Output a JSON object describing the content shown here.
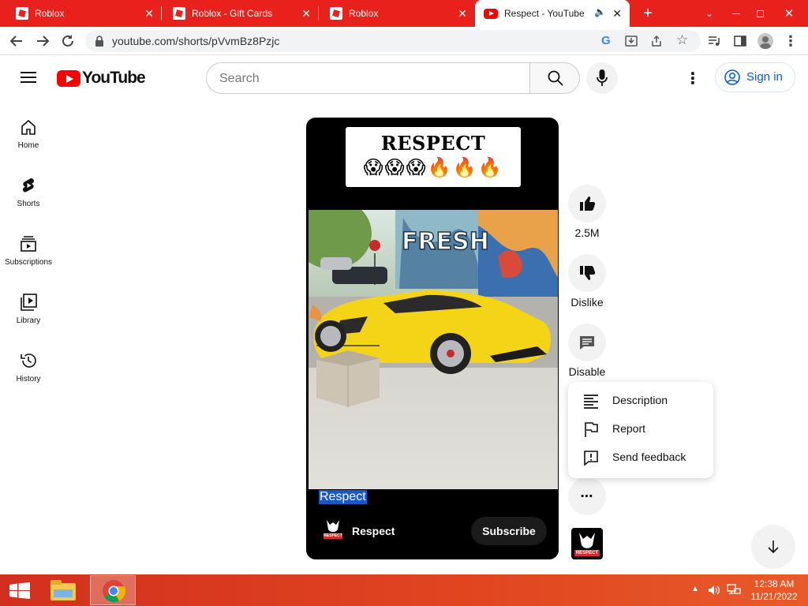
{
  "browser": {
    "tabs": [
      {
        "title": "Roblox",
        "active": false
      },
      {
        "title": "Roblox - Gift Cards",
        "active": false
      },
      {
        "title": "Roblox",
        "active": false
      },
      {
        "title": "Respect - YouTube",
        "active": true
      }
    ],
    "url": "youtube.com/shorts/pVvmBz8Pzjc"
  },
  "youtube": {
    "logo_text": "YouTube",
    "search": {
      "placeholder": "Search",
      "value": ""
    },
    "sign_in_label": "Sign in",
    "sidebar": [
      {
        "label": "Home",
        "icon": "home-icon"
      },
      {
        "label": "Shorts",
        "icon": "shorts-icon"
      },
      {
        "label": "Subscriptions",
        "icon": "subscriptions-icon"
      },
      {
        "label": "Library",
        "icon": "library-icon"
      },
      {
        "label": "History",
        "icon": "history-icon"
      }
    ]
  },
  "short": {
    "banner_title": "RESPECT",
    "banner_emoji": "😱😱😱🔥🔥🔥",
    "caption": "Respect",
    "channel_name": "Respect",
    "channel_avatar_text": "RESPECT",
    "subscribe_label": "Subscribe",
    "video_sign_text": "FRESH"
  },
  "actions": {
    "like_count": "2.5M",
    "dislike_label": "Dislike",
    "comments_label": "Disable"
  },
  "menu": {
    "items": [
      {
        "label": "Description",
        "icon": "description-icon"
      },
      {
        "label": "Report",
        "icon": "flag-icon"
      },
      {
        "label": "Send feedback",
        "icon": "feedback-icon"
      }
    ]
  },
  "taskbar": {
    "time": "12:38 AM",
    "date": "11/21/2022"
  },
  "colors": {
    "tab_strip": "#e8211c",
    "youtube_red": "#ff0000",
    "sign_in_blue": "#065fd4",
    "car_yellow": "#f3d417"
  }
}
